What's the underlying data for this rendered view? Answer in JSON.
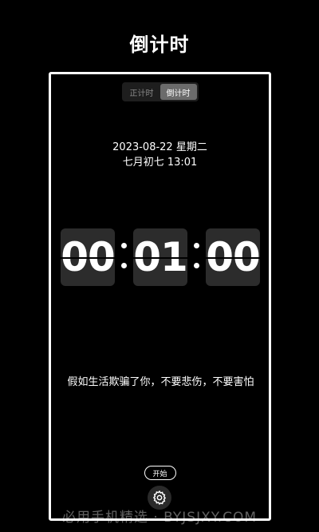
{
  "page": {
    "title": "倒计时"
  },
  "mode_switch": {
    "tabs": [
      {
        "label": "正计时"
      },
      {
        "label": "倒计时",
        "active": true
      }
    ]
  },
  "datetime": {
    "line1": "2023-08-22  星期二",
    "line2": "七月初七  13:01"
  },
  "timer": {
    "hours": "00",
    "minutes": "01",
    "seconds": "00"
  },
  "quote": "假如生活欺骗了你，不要悲伤，不要害怕",
  "controls": {
    "start_label": "开始",
    "settings_icon": "gear-icon"
  },
  "watermark": "必用手机精选 · BYJSJXY.COM",
  "colors": {
    "background": "#000000",
    "digit_box": "#2c2c2c",
    "frame": "#ffffff",
    "active_tab": "#6b6b6b"
  }
}
